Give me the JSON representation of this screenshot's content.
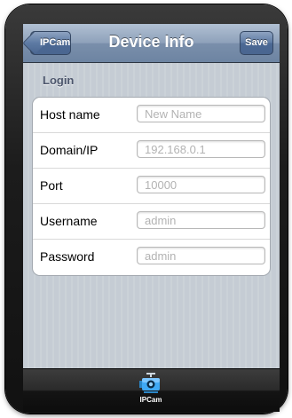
{
  "nav": {
    "back_label": "IPCam",
    "title": "Device Info",
    "save_label": "Save"
  },
  "section": {
    "header": "Login"
  },
  "fields": [
    {
      "label": "Host name",
      "value": "",
      "placeholder": "New Name"
    },
    {
      "label": "Domain/IP",
      "value": "",
      "placeholder": "192.168.0.1"
    },
    {
      "label": "Port",
      "value": "",
      "placeholder": "10000"
    },
    {
      "label": "Username",
      "value": "",
      "placeholder": "admin"
    },
    {
      "label": "Password",
      "value": "",
      "placeholder": "admin"
    }
  ],
  "tab_bar": {
    "items": [
      {
        "label": "IPCam",
        "icon": "camera-icon"
      }
    ]
  },
  "colors": {
    "nav_bar": "#7a8fab",
    "tab_icon": "#3fa9f5"
  }
}
